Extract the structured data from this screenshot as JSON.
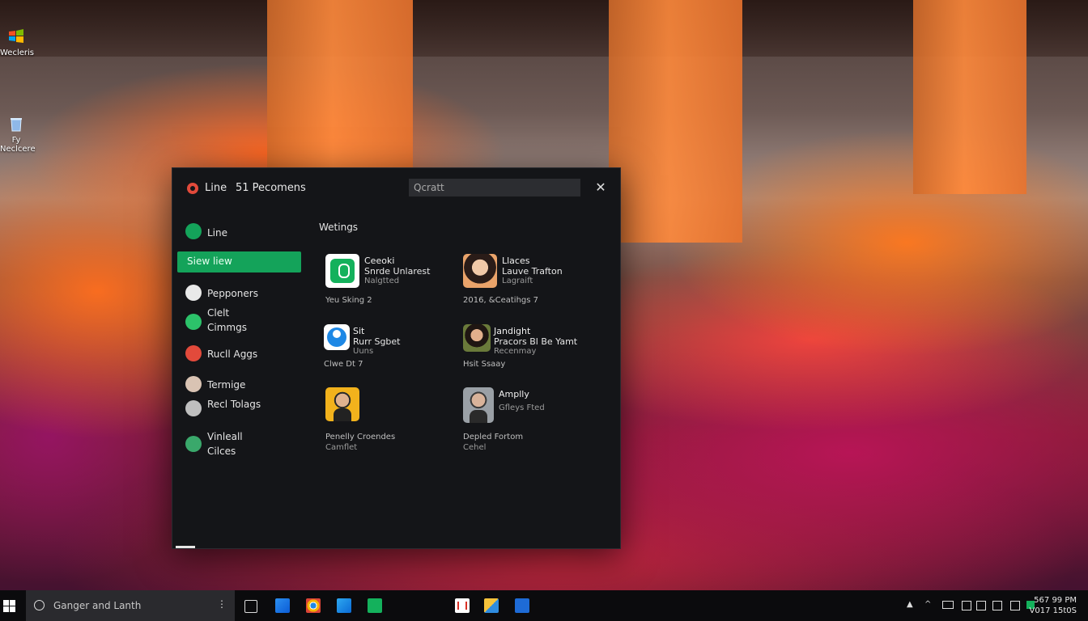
{
  "desktop": {
    "icons": [
      {
        "label": "Wecleris",
        "icon": "windows-logo-icon"
      },
      {
        "label": "Fy Neclcere",
        "icon": "recycle-bin-icon"
      }
    ]
  },
  "window": {
    "app_name": "Line",
    "subtitle": "51 Pecomens",
    "search_placeholder": "Qcratt",
    "close_icon": "close-icon",
    "sidebar": {
      "top_item": "Line",
      "selected_item": "Siew liew",
      "items": [
        {
          "label": "Pepponers",
          "icon": "person-icon"
        },
        {
          "label": "Clelt\nCimmgs",
          "icon": "chat-icon"
        },
        {
          "label": "Rucll Aggs",
          "icon": "apps-icon"
        },
        {
          "label": "Termige",
          "icon": "person-icon"
        },
        {
          "label": "Recl Tolags",
          "icon": "person-icon"
        },
        {
          "label": "Vinleall\nCilces",
          "icon": "globe-icon"
        }
      ]
    },
    "section_title": "Wetings",
    "cards": [
      {
        "line1": "Ceeoki",
        "line2": "Snrde Unlarest",
        "line3": "Nalgtted",
        "foot": "Yeu Sking 2",
        "foot2": "",
        "icon": "line-app-icon"
      },
      {
        "line1": "Llaces",
        "line2": "Lauve Trafton",
        "line3": "Lagraift",
        "foot": "2016, &Ceatihgs 7",
        "foot2": "",
        "icon": "avatar-woman-icon"
      },
      {
        "line1": "Sit",
        "line2": "Rurr Sgbet",
        "line3": "Uuns",
        "foot": "Clwe Dt 7",
        "foot2": "",
        "icon": "contact-icon"
      },
      {
        "line1": "Jandight",
        "line2": "Pracors Bl Be Yamt",
        "line3": "Recenmay",
        "foot": "Hsit Ssaay",
        "foot2": "",
        "icon": "avatar-woman-icon"
      },
      {
        "line1": "",
        "line2": "",
        "line3": "",
        "foot": "Penelly Croendes",
        "foot2": "Camflet",
        "icon": "avatar-man-icon"
      },
      {
        "line1": "Amplly",
        "line2": "",
        "line3": "Gfleys Fted",
        "foot": "Depled Fortom",
        "foot2": "Cehel",
        "icon": "avatar-man-icon"
      }
    ]
  },
  "taskbar": {
    "search_text": "Ganger and Lanth",
    "clock_time": "567 99 PM",
    "clock_date": "V017 15t0S",
    "apps": [
      "task-view-icon",
      "store-icon",
      "chrome-icon",
      "edge-icon",
      "line-icon",
      "gmail-icon",
      "photos-icon",
      "calendar-icon"
    ]
  },
  "colors": {
    "accent": "#14a35a",
    "window_bg": "#141518",
    "taskbar_bg": "#0b0b0d"
  }
}
